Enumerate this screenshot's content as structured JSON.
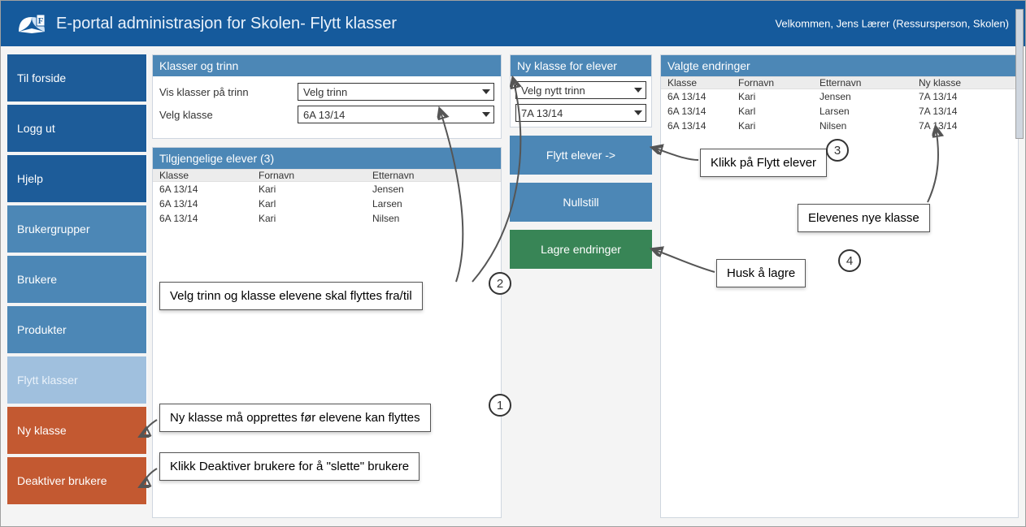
{
  "header": {
    "title": "E-portal administrasjon for Skolen- Flytt klasser",
    "welcome": "Velkommen, Jens Lærer (Ressursperson, Skolen)"
  },
  "sidebar": {
    "items": [
      {
        "label": "Til forside",
        "style": "nav-dark"
      },
      {
        "label": "Logg ut",
        "style": "nav-dark"
      },
      {
        "label": "Hjelp",
        "style": "nav-dark"
      },
      {
        "label": "Brukergrupper",
        "style": "nav-med"
      },
      {
        "label": "Brukere",
        "style": "nav-med"
      },
      {
        "label": "Produkter",
        "style": "nav-med"
      },
      {
        "label": "Flytt klasser",
        "style": "nav-light"
      },
      {
        "label": "Ny klasse",
        "style": "nav-orange"
      },
      {
        "label": "Deaktiver brukere",
        "style": "nav-orange"
      }
    ]
  },
  "panels": {
    "classes": {
      "title": "Klasser og trinn",
      "show_label": "Vis klasser på trinn",
      "show_value": "Velg trinn",
      "choose_label": "Velg klasse",
      "choose_value": "6A 13/14"
    },
    "available": {
      "title": "Tilgjengelige elever (3)",
      "cols": [
        "Klasse",
        "Fornavn",
        "Etternavn"
      ],
      "rows": [
        {
          "klasse": "6A 13/14",
          "fornavn": "Kari",
          "etternavn": "Jensen"
        },
        {
          "klasse": "6A 13/14",
          "fornavn": "Karl",
          "etternavn": "Larsen"
        },
        {
          "klasse": "6A 13/14",
          "fornavn": "Kari",
          "etternavn": "Nilsen"
        }
      ]
    },
    "newclass": {
      "title": "Ny klasse for elever",
      "sel_grade": "Velg nytt trinn",
      "sel_class": "7A 13/14",
      "btn_move": "Flytt elever ->",
      "btn_reset": "Nullstill",
      "btn_save": "Lagre endringer"
    },
    "changes": {
      "title": "Valgte endringer",
      "cols": [
        "Klasse",
        "Fornavn",
        "Etternavn",
        "Ny klasse"
      ],
      "rows": [
        {
          "klasse": "6A 13/14",
          "fornavn": "Kari",
          "etternavn": "Jensen",
          "ny": "7A 13/14"
        },
        {
          "klasse": "6A 13/14",
          "fornavn": "Karl",
          "etternavn": "Larsen",
          "ny": "7A 13/14"
        },
        {
          "klasse": "6A 13/14",
          "fornavn": "Kari",
          "etternavn": "Nilsen",
          "ny": "7A 13/14"
        }
      ]
    }
  },
  "annotations": {
    "n1": "1",
    "t1": "Ny klasse må opprettes før elevene kan flyttes",
    "n2": "2",
    "t2": "Velg trinn og klasse elevene skal flyttes fra/til",
    "n3": "3",
    "t3": "Klikk på Flytt elever",
    "n4": "4",
    "t4": "Husk å lagre",
    "t5": "Elevenes nye klasse",
    "t6": "Klikk Deaktiver brukere for å \"slette\" brukere"
  }
}
